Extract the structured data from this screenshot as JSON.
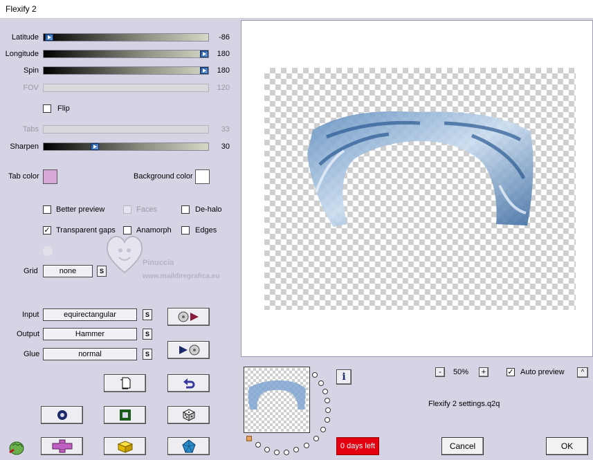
{
  "window": {
    "title": "Flexify 2"
  },
  "sliders": [
    {
      "label": "Latitude",
      "value": "-86",
      "position": 0.03,
      "enabled": true
    },
    {
      "label": "Longitude",
      "value": "180",
      "position": 1.0,
      "enabled": true
    },
    {
      "label": "Spin",
      "value": "180",
      "position": 1.0,
      "enabled": true
    },
    {
      "label": "FOV",
      "value": "120",
      "enabled": false
    },
    {
      "label": "Tabs",
      "value": "33",
      "enabled": false
    },
    {
      "label": "Sharpen",
      "value": "30",
      "position": 0.3,
      "enabled": true
    }
  ],
  "flip": {
    "label": "Flip",
    "checked": false,
    "mark": ""
  },
  "colors": {
    "tab_color_label": "Tab color",
    "tab_color": "#d7a8d8",
    "background_color_label": "Background color",
    "background_color": "#ffffff"
  },
  "options": {
    "better_preview": {
      "label": "Better preview",
      "checked": false,
      "mark": ""
    },
    "faces": {
      "label": "Faces",
      "checked": false,
      "enabled": false,
      "mark": ""
    },
    "de_halo": {
      "label": "De-halo",
      "checked": false,
      "mark": ""
    },
    "transparent_gaps": {
      "label": "Transparent gaps",
      "checked": true,
      "mark": "✓"
    },
    "anamorph": {
      "label": "Anamorph",
      "checked": false,
      "mark": ""
    },
    "edges": {
      "label": "Edges",
      "checked": false,
      "mark": ""
    }
  },
  "grid": {
    "label": "Grid",
    "value": "none",
    "s": "S"
  },
  "projection": {
    "input": {
      "label": "Input",
      "value": "equirectangular",
      "s": "S"
    },
    "output": {
      "label": "Output",
      "value": "Hammer",
      "s": "S"
    },
    "glue": {
      "label": "Glue",
      "value": "normal",
      "s": "S"
    }
  },
  "watermark": {
    "line1": "Pinuccia",
    "line2": "www.maildiregrafica.eu"
  },
  "zoom": {
    "minus": "-",
    "value": "50%",
    "plus": "+"
  },
  "auto_preview": {
    "label": "Auto preview",
    "checked": true,
    "mark": "✓",
    "collapse": "^"
  },
  "info_button": "i",
  "settings_file": "Flexify 2 settings.q2q",
  "trial": "0 days left",
  "buttons": {
    "cancel": "Cancel",
    "ok": "OK"
  },
  "icons": {
    "tool_row1": "copy-icon",
    "tool_row1b": "undo-icon",
    "tool_row2a": "circle-icon",
    "tool_row2b": "square-frame-icon",
    "tool_row2c": "dice-icon",
    "tool_row3a": "plus-icon",
    "tool_row3b": "cube-icon",
    "tool_row3c": "pentagon-icon"
  }
}
